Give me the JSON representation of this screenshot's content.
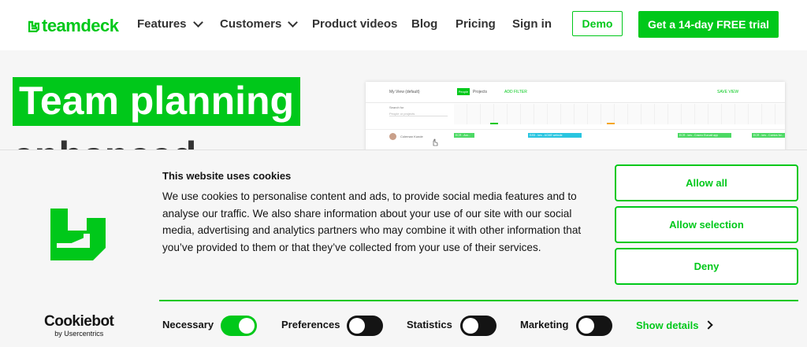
{
  "header": {
    "logo_text": "teamdeck",
    "nav": [
      {
        "label": "Features",
        "dropdown": true
      },
      {
        "label": "Customers",
        "dropdown": true
      },
      {
        "label": "Product videos",
        "dropdown": false
      },
      {
        "label": "Blog",
        "dropdown": false
      },
      {
        "label": "Pricing",
        "dropdown": false
      },
      {
        "label": "Sign in",
        "dropdown": false
      }
    ],
    "demo_label": "Demo",
    "trial_label": "Get a 14-day FREE trial"
  },
  "hero": {
    "headline_line1": "Team planning",
    "headline_line2": "enhanced"
  },
  "app_preview": {
    "view_label": "My View (default)",
    "toggle_people": "People",
    "toggle_projects": "Projects",
    "add_filter": "ADD FILTER",
    "save_view": "SAVE VIEW",
    "search_label": "Search for",
    "search_placeholder": "People or projects",
    "person_name": "Coleman Kunde",
    "bars": [
      "ECR - Acc...",
      "E/05 - kes - ACME website",
      "ECR - kes - Cosmo Euroalt app",
      "ECR - kes - Comics for..."
    ]
  },
  "cookie": {
    "title": "This website uses cookies",
    "body": "We use cookies to personalise content and ads, to provide social media features and to analyse our traffic. We also share information about your use of our site with our social media, advertising and analytics partners who may combine it with other information that you’ve provided to them or that they’ve collected from your use of their services.",
    "buttons": {
      "allow_all": "Allow all",
      "allow_selection": "Allow selection",
      "deny": "Deny"
    },
    "brand": {
      "name": "Cookiebot",
      "sub": "by Usercentrics"
    },
    "toggles": [
      {
        "label": "Necessary",
        "on": true
      },
      {
        "label": "Preferences",
        "on": false
      },
      {
        "label": "Statistics",
        "on": false
      },
      {
        "label": "Marketing",
        "on": false
      }
    ],
    "show_details": "Show details"
  },
  "colors": {
    "brand_green": "#00c81a",
    "dark": "#141414",
    "toggle_off": "#141414"
  }
}
